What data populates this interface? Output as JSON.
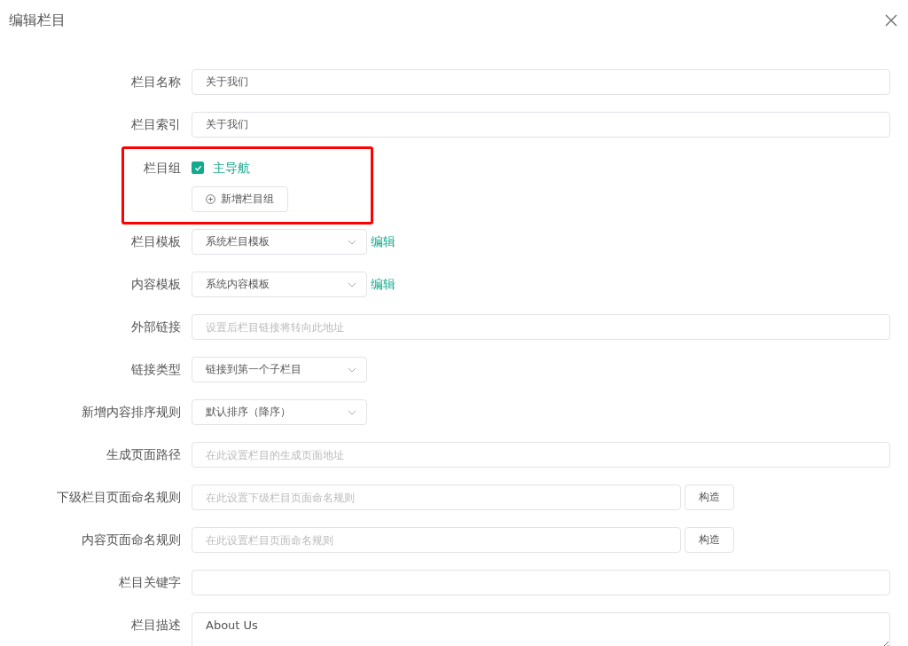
{
  "dialog": {
    "title": "编辑栏目"
  },
  "fields": [
    {
      "kind": "text",
      "label": "栏目名称",
      "value": "关于我们"
    },
    {
      "kind": "text",
      "label": "栏目索引",
      "value": "关于我们"
    },
    {
      "kind": "group",
      "label": "栏目组",
      "options": [
        {
          "label": "主导航",
          "checked": true
        }
      ],
      "button": "新增栏目组"
    },
    {
      "kind": "select",
      "label": "栏目模板",
      "value": "系统栏目模板",
      "link": "编辑"
    },
    {
      "kind": "select",
      "label": "内容模板",
      "value": "系统内容模板",
      "link": "编辑"
    },
    {
      "kind": "text",
      "label": "外部链接",
      "placeholder": "设置后栏目链接将转向此地址"
    },
    {
      "kind": "select",
      "label": "链接类型",
      "value": "链接到第一个子栏目"
    },
    {
      "kind": "select",
      "label": "新增内容排序规则",
      "value": "默认排序（降序）"
    },
    {
      "kind": "text",
      "label": "生成页面路径",
      "placeholder": "在此设置栏目的生成页面地址"
    },
    {
      "kind": "build",
      "label": "下级栏目页面命名规则",
      "placeholder": "在此设置下级栏目页面命名规则",
      "button": "构造"
    },
    {
      "kind": "build",
      "label": "内容页面命名规则",
      "placeholder": "在此设置栏目页面命名规则",
      "button": "构造"
    },
    {
      "kind": "text",
      "label": "栏目关键字"
    },
    {
      "kind": "textarea",
      "label": "栏目描述",
      "value": "About Us"
    }
  ]
}
